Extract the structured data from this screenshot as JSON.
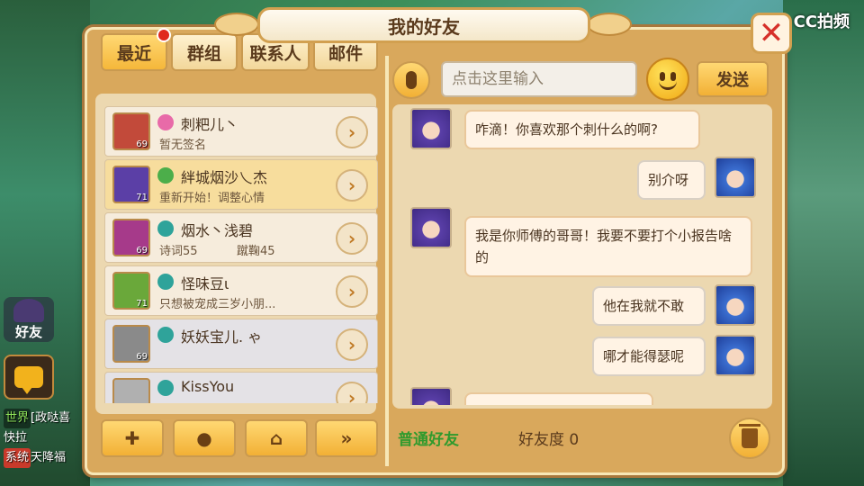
{
  "dialog": {
    "title": "我的好友"
  },
  "watermark": "CC拍频",
  "hud": {
    "friend_label": "好友"
  },
  "world_chat": [
    {
      "tag": "世界",
      "text": "[政哒喜",
      "tag_color": "#8fe35a"
    },
    {
      "tag": "",
      "text": "快拉",
      "tag_color": ""
    },
    {
      "tag": "系统",
      "text": "天降福",
      "tag_color": "#c83a2b"
    }
  ],
  "tabs": [
    {
      "label": "最近",
      "active": true,
      "badge": true
    },
    {
      "label": "群组",
      "active": false,
      "badge": false
    },
    {
      "label": "联系人",
      "active": false,
      "badge": false
    },
    {
      "label": "邮件",
      "active": false,
      "badge": false
    }
  ],
  "friends": [
    {
      "name": "刺粑儿丶",
      "sub": "暂无签名",
      "sub2": "",
      "level": "69",
      "sect_color": "#e86aa8",
      "avatar_bg": "#c24a3a",
      "selected": false,
      "grey": false
    },
    {
      "name": "絆城烟沙乀杰",
      "sub": "重新开始！调整心情",
      "sub2": "",
      "level": "71",
      "sect_color": "#4cae4a",
      "avatar_bg": "#5b3fa6",
      "selected": true,
      "grey": false
    },
    {
      "name": "烟水丶浅碧",
      "sub": "诗词55",
      "sub2": "蹴鞠45",
      "level": "69",
      "sect_color": "#2fa39a",
      "avatar_bg": "#a63a8a",
      "selected": false,
      "grey": false
    },
    {
      "name": "怪味豆ι",
      "sub": "只想被宠成三岁小朋...",
      "sub2": "",
      "level": "71",
      "sect_color": "#2fa39a",
      "avatar_bg": "#6aa83a",
      "selected": false,
      "grey": false
    },
    {
      "name": "妖妖宝儿. ゃ",
      "sub": "",
      "sub2": "",
      "level": "69",
      "sect_color": "#2fa39a",
      "avatar_bg": "#8a8a8a",
      "selected": false,
      "grey": true
    },
    {
      "name": "KissYou",
      "sub": "",
      "sub2": "",
      "level": "",
      "sect_color": "#2fa39a",
      "avatar_bg": "#b0b0b0",
      "selected": false,
      "grey": true
    }
  ],
  "bottom_buttons": [
    {
      "name": "add-friend-button",
      "glyph": "+",
      "icon": "add-user-icon"
    },
    {
      "name": "chat-button",
      "glyph": "●",
      "icon": "chat-bubble-icon"
    },
    {
      "name": "home-button",
      "glyph": "⌂",
      "icon": "home-icon"
    },
    {
      "name": "more-button",
      "glyph": "»",
      "icon": "double-chevron-icon"
    }
  ],
  "input": {
    "placeholder": "点击这里输入"
  },
  "send_label": "发送",
  "messages": [
    {
      "side": "left",
      "text": "咋滴！你喜欢那个刺什么的啊?"
    },
    {
      "side": "right",
      "text": "别介呀"
    },
    {
      "side": "left",
      "text": "我是你师傅的哥哥！我要不要打个小报告啥的"
    },
    {
      "side": "right",
      "text": "他在我就不敢"
    },
    {
      "side": "right",
      "text": "哪才能得瑟呢"
    },
    {
      "side": "left",
      "text": ""
    }
  ],
  "footer": {
    "friend_type": "普通好友",
    "affinity": "好友度 0"
  }
}
